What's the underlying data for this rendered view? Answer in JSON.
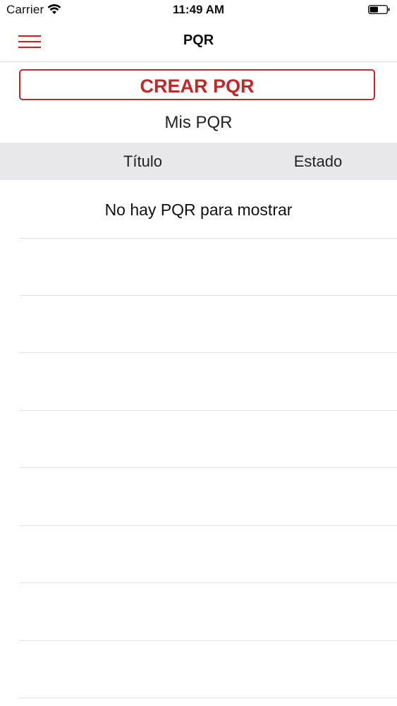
{
  "status_bar": {
    "carrier": "Carrier",
    "time": "11:49 AM",
    "wifi_icon": "wifi-icon",
    "battery_icon": "battery-icon",
    "battery_level": 0.5
  },
  "nav": {
    "menu_icon": "hamburger-menu-icon",
    "title": "PQR"
  },
  "actions": {
    "create_label": "CREAR PQR"
  },
  "list": {
    "section_title": "Mis PQR",
    "columns": [
      "Título",
      "Estado"
    ],
    "empty_message": "No hay PQR para mostrar",
    "rows": []
  },
  "colors": {
    "accent": "#c0292b",
    "header_bg": "#e8e8ea",
    "separator": "#e4e4e4"
  }
}
